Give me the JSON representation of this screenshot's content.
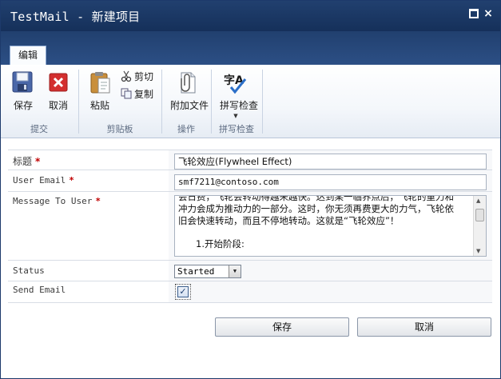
{
  "window": {
    "title_app": "TestMail",
    "title_sep": " - ",
    "title_page": "新建项目",
    "close_glyph": "×"
  },
  "ribbon": {
    "tab_label": "编辑",
    "groups": {
      "commit": {
        "label": "提交",
        "save_label": "保存",
        "cancel_label": "取消"
      },
      "clipboard": {
        "label": "剪贴板",
        "paste_label": "粘贴",
        "cut_label": "剪切",
        "copy_label": "复制"
      },
      "actions": {
        "label": "操作",
        "attach_label": "附加文件"
      },
      "spelling": {
        "label": "拼写检查",
        "spell_label": "拼写检查",
        "spell_icon_glyph": "字A",
        "dropdown_glyph": "▼"
      }
    }
  },
  "form": {
    "title": {
      "label": "标题",
      "required_mark": "*",
      "value": "飞轮效应(Flywheel Effect)"
    },
    "user_email": {
      "label": "User Email",
      "required_mark": "*",
      "value": "smf7211@contoso.com"
    },
    "message": {
      "label": "Message To User",
      "required_mark": "*",
      "para_line1": "会日费，飞轮会转动得越来越快。达到某一临界点后，飞轮的重力和",
      "para_line2": "冲力会成为推动力的一部分。这时，你无须再费更大的力气，飞轮依",
      "para_line3": "旧会快速转动，而且不停地转动。这就是“飞轮效应”！",
      "list_item": "1.开始阶段:"
    },
    "status": {
      "label": "Status",
      "value": "Started",
      "arrow_glyph": "▼"
    },
    "send_email": {
      "label": "Send Email",
      "checked": true,
      "check_glyph": "✓"
    }
  },
  "buttons": {
    "save_label": "保存",
    "cancel_label": "取消"
  },
  "scrollbar": {
    "up_glyph": "▲",
    "down_glyph": "▼"
  },
  "colors": {
    "title_bar": "#1b3865",
    "required": "#c00000",
    "ribbon_text": "#5c6a80"
  }
}
